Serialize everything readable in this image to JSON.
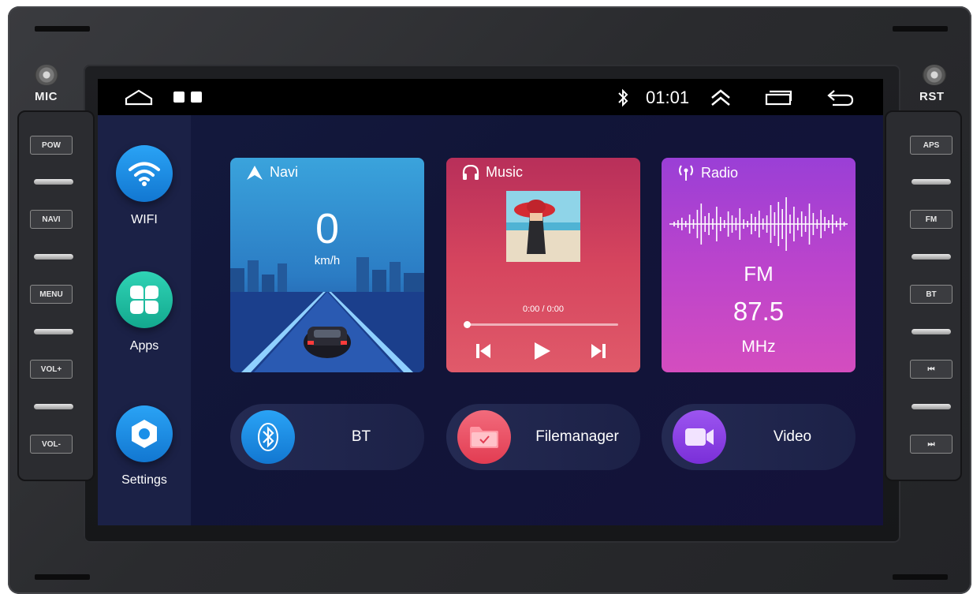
{
  "bezel": {
    "mic_label": "MIC",
    "rst_label": "RST",
    "left_buttons": [
      "POW",
      "NAVI",
      "MENU",
      "VOL+",
      "VOL-"
    ],
    "right_buttons": [
      "APS",
      "FM",
      "BT",
      "⏮",
      "⏭"
    ]
  },
  "status_bar": {
    "time": "01:01",
    "bluetooth_icon": "bluetooth-icon",
    "home_icon": "home-icon",
    "recents_icon": "recent-apps-icon",
    "expand_icon": "chevron-up-double-icon",
    "window_icon": "window-icon",
    "back_icon": "back-icon"
  },
  "dock": {
    "items": [
      {
        "label": "WIFI",
        "icon": "wifi-icon",
        "color": "#1a8fe8"
      },
      {
        "label": "Apps",
        "icon": "apps-icon",
        "color": "#16b39a"
      },
      {
        "label": "Settings",
        "icon": "settings-icon",
        "color": "#1a8fe8"
      }
    ]
  },
  "cards": {
    "navi": {
      "title": "Navi",
      "speed": "0",
      "unit": "km/h"
    },
    "music": {
      "title": "Music",
      "time": "0:00 / 0:00",
      "progress": 0
    },
    "radio": {
      "title": "Radio",
      "band": "FM",
      "frequency": "87.5",
      "unit": "MHz"
    }
  },
  "shortcuts": [
    {
      "label": "BT",
      "icon": "bluetooth-icon",
      "color": "#1a8fe8"
    },
    {
      "label": "Filemanager",
      "icon": "folder-icon",
      "color": "#ee4a5e"
    },
    {
      "label": "Video",
      "icon": "video-camera-icon",
      "color": "#8b3fe0"
    }
  ],
  "colors": {
    "navi_gradient": [
      "#3a9fd8",
      "#1b4f9a"
    ],
    "music_gradient": [
      "#c53a5c",
      "#e0556a"
    ],
    "radio_gradient": [
      "#a33fd0",
      "#e25fc0"
    ]
  }
}
